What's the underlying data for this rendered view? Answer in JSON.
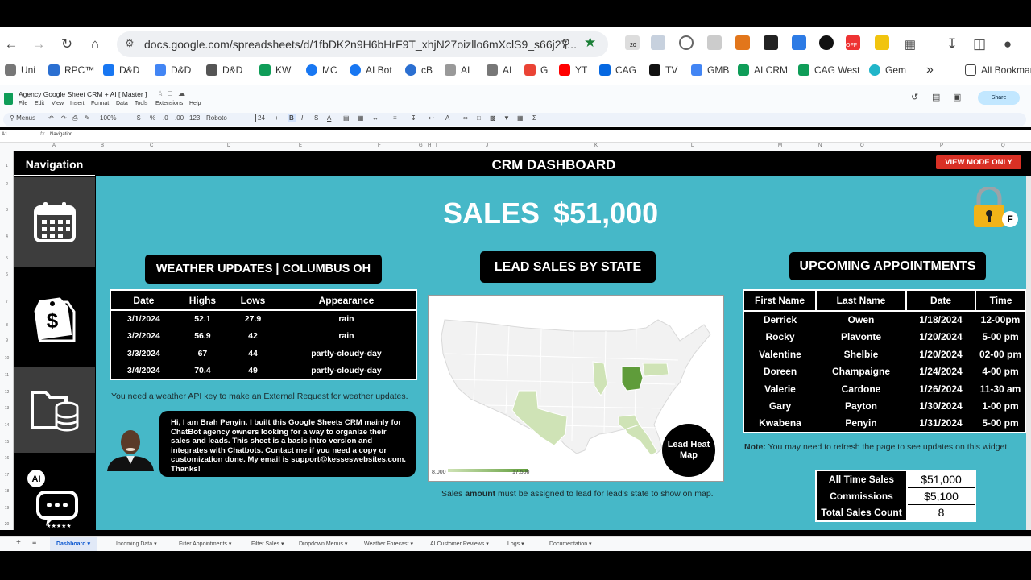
{
  "browser": {
    "url": "docs.google.com/spreadsheets/d/1fbDK2n9H6bHrF9T_xhjN27oizllo6mXclS9_s66j27...",
    "bookmarks": [
      "Uni",
      "RPC™",
      "D&D",
      "D&D",
      "D&D",
      "KW",
      "MC",
      "AI Bot",
      "cB",
      "AI",
      "AI",
      "G",
      "YT",
      "CAG",
      "TV",
      "GMB",
      "AI CRM",
      "CAG West",
      "Gem"
    ],
    "all_bookmarks": "All Bookmarks",
    "ext_badges": [
      "20",
      "OFF"
    ]
  },
  "sheets": {
    "doc_title": "Agency Google Sheet CRM + AI [ Master ]",
    "menus": [
      "File",
      "Edit",
      "View",
      "Insert",
      "Format",
      "Data",
      "Tools",
      "Extensions",
      "Help"
    ],
    "share_label": "Share",
    "toolbar": {
      "menus_search": "Menus",
      "zoom": "100%",
      "currency": "$",
      "percent": "%",
      "dec1": ".0",
      "dec2": ".00",
      "format": "123",
      "font": "Roboto",
      "font_size": "24"
    },
    "cell_ref": "A1",
    "fx": "fx",
    "formula": "Navigation",
    "columns": [
      "A",
      "B",
      "C",
      "D",
      "E",
      "F",
      "G",
      "H",
      "I",
      "J",
      "K",
      "L",
      "M",
      "N",
      "O",
      "P",
      "Q"
    ],
    "rows": [
      "1",
      "2",
      "3",
      "4",
      "5",
      "6",
      "7",
      "8",
      "9",
      "10",
      "11",
      "12",
      "13",
      "14",
      "15",
      "16",
      "17",
      "18",
      "19",
      "20"
    ],
    "sheet_tabs": [
      "Dashboard",
      "Incoming Data",
      "Filter Appointments",
      "Filter Sales",
      "Dropdown Menus",
      "Weather Forecast",
      "AI Customer Reviews",
      "Logs",
      "Documentation"
    ]
  },
  "dashboard": {
    "nav_title": "Navigation",
    "header": "CRM DASHBOARD",
    "view_mode": "VIEW MODE ONLY",
    "sales_label": "SALES",
    "sales_value": "$51,000",
    "lock_badge": "F",
    "weather": {
      "title": "WEATHER UPDATES | COLUMBUS OH",
      "headers": [
        "Date",
        "Highs",
        "Lows",
        "Appearance"
      ],
      "rows": [
        [
          "3/1/2024",
          "52.1",
          "27.9",
          "rain"
        ],
        [
          "3/2/2024",
          "56.9",
          "42",
          "rain"
        ],
        [
          "3/3/2024",
          "67",
          "44",
          "partly-cloudy-day"
        ],
        [
          "3/4/2024",
          "70.4",
          "49",
          "partly-cloudy-day"
        ]
      ],
      "note": "You need a weather API key to make an External Request for weather updates."
    },
    "bio": "Hi, I am Brah Penyin. I built this Google Sheets CRM mainly for ChatBot agency owners looking for a way to organize their sales and leads. This sheet is a basic intro version and integrates with Chatbots. Contact me if you need a copy or customization done. My email is support@kesseswebsites.com. Thanks!",
    "map": {
      "title": "LEAD SALES BY STATE",
      "heat_label": "Lead Heat Map",
      "legend_min": "8,000",
      "legend_max": "17,500",
      "note_pre": "Sales ",
      "note_bold": "amount",
      "note_post": " must be assigned to lead for lead's state to show on map.",
      "colors": {
        "base": "#f2f2f2",
        "low": "#cfe3b6",
        "high": "#5f9c3a",
        "border": "#ffffff"
      }
    },
    "appointments": {
      "title": "UPCOMING APPOINTMENTS",
      "headers": [
        "First Name",
        "Last Name",
        "Date",
        "Time"
      ],
      "rows": [
        [
          "Derrick",
          "Owen",
          "1/18/2024",
          "12-00pm"
        ],
        [
          "Rocky",
          "Plavonte",
          "1/20/2024",
          "5-00 pm"
        ],
        [
          "Valentine",
          "Shelbie",
          "1/20/2024",
          "02-00 pm"
        ],
        [
          "Doreen",
          "Champaigne",
          "1/24/2024",
          "4-00 pm"
        ],
        [
          "Valerie",
          "Cardone",
          "1/26/2024",
          "11-30 am"
        ],
        [
          "Gary",
          "Payton",
          "1/30/2024",
          "1-00 pm"
        ],
        [
          "Kwabena",
          "Penyin",
          "1/31/2024",
          "5-00 pm"
        ]
      ],
      "note_bold": "Note:",
      "note": " You may need to refresh the page to see updates on this widget."
    },
    "stats": [
      {
        "label": "All Time Sales",
        "value": "$51,000"
      },
      {
        "label": "Commissions",
        "value": "$5,100"
      },
      {
        "label": "Total Sales Count",
        "value": "8"
      }
    ],
    "colors": {
      "teal": "#46b8c8",
      "tile": "#3d3d3d",
      "view_mode": "#d93025",
      "lock": "#f2b318"
    }
  }
}
